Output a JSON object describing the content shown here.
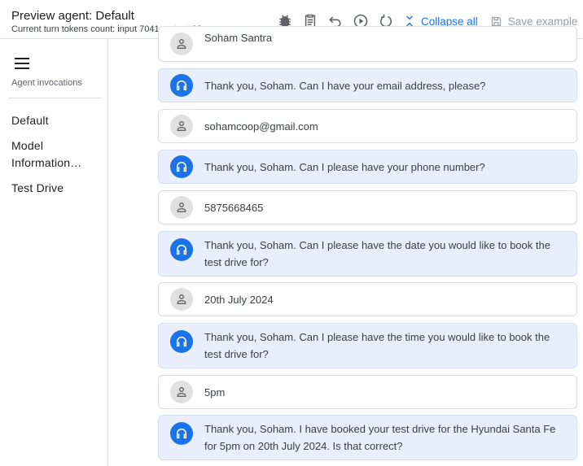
{
  "header": {
    "title": "Preview agent: Default",
    "subtitle": "Current turn tokens count: input 7041, output 82",
    "collapse_label": "Collapse all",
    "save_label": "Save example"
  },
  "sidebar": {
    "caption": "Agent invocations",
    "items": [
      {
        "label": "Default"
      },
      {
        "label": "Model"
      },
      {
        "label": "Information…"
      },
      {
        "label": "Test Drive"
      }
    ]
  },
  "messages": [
    {
      "role": "user",
      "text": "Soham Santra"
    },
    {
      "role": "agent",
      "text": "Thank you, Soham. Can I have your email address, please?"
    },
    {
      "role": "user",
      "text": "sohamcoop@gmail.com"
    },
    {
      "role": "agent",
      "text": "Thank you, Soham. Can I please have your phone number?"
    },
    {
      "role": "user",
      "text": "5875668465"
    },
    {
      "role": "agent",
      "text": "Thank you, Soham. Can I please have the date you would like to book the test drive for?"
    },
    {
      "role": "user",
      "text": "20th July 2024"
    },
    {
      "role": "agent",
      "text": "Thank you, Soham. Can I please have the time you would like to book the test drive for?"
    },
    {
      "role": "user",
      "text": "5pm"
    },
    {
      "role": "agent",
      "text": "Thank you, Soham. I have booked your test drive for the Hyundai Santa Fe for 5pm on 20th July 2024. Is that correct?"
    }
  ],
  "colors": {
    "accent": "#1a73e8",
    "agent_bubble": "#e8eefa"
  }
}
